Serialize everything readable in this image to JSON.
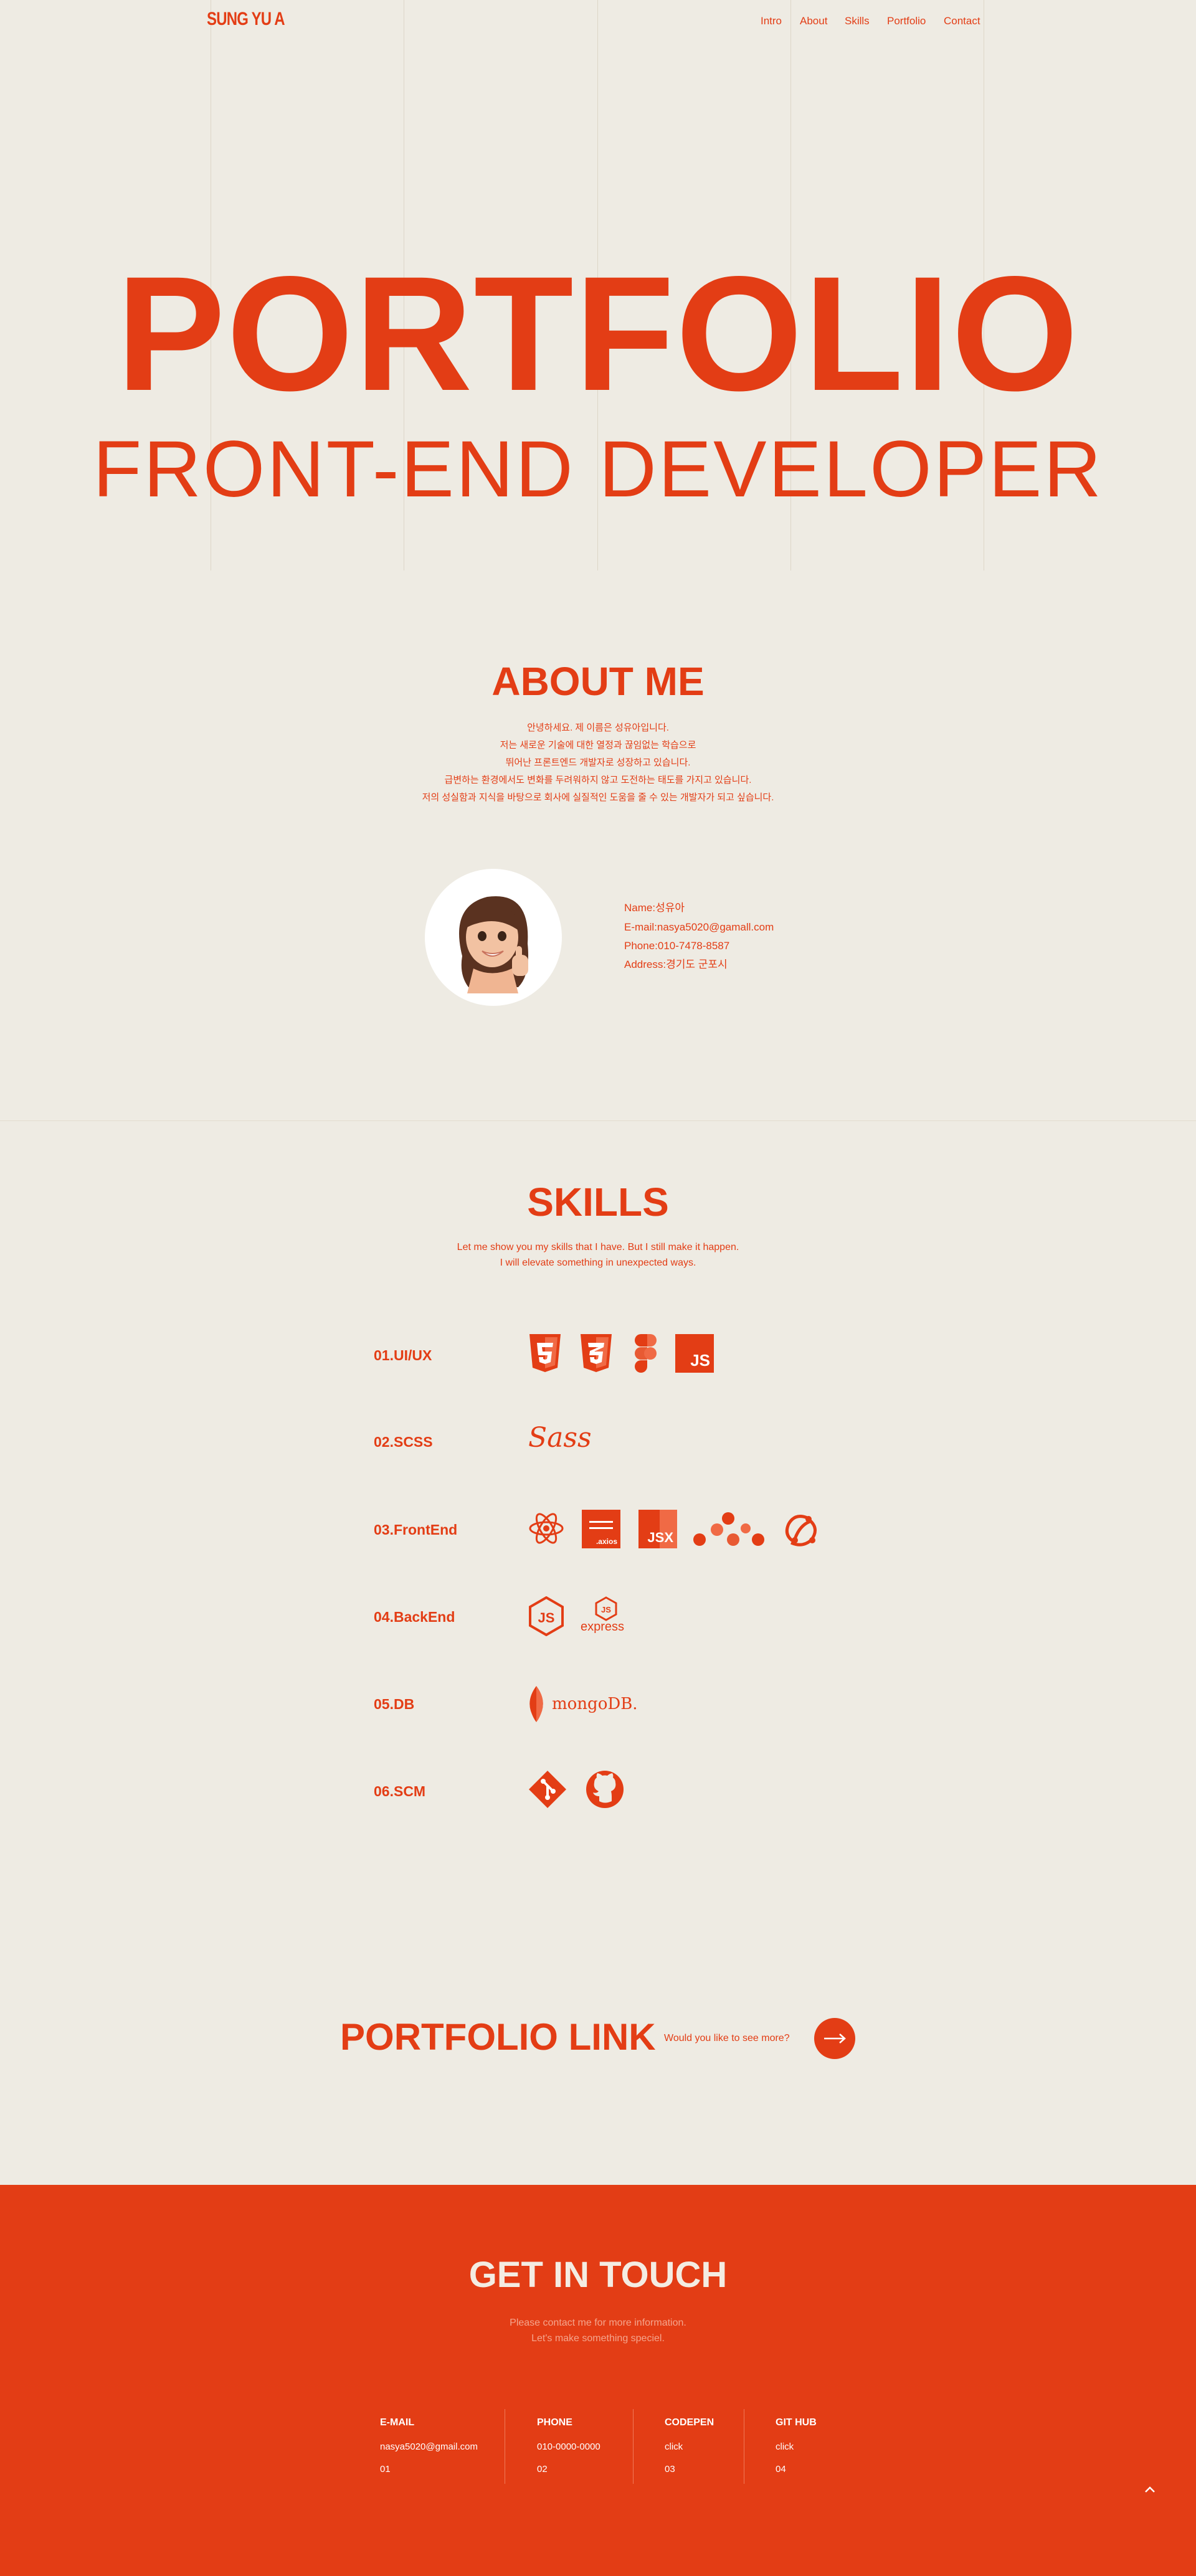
{
  "header": {
    "logo": "SUNG YU A",
    "nav": [
      "Intro",
      "About",
      "Skills",
      "Portfolio",
      "Contact"
    ]
  },
  "hero": {
    "title": "PORTFOLIO",
    "subtitle": "FRONT-END DEVELOPER"
  },
  "about": {
    "title": "ABOUT ME",
    "lines": [
      "안녕하세요. 제 이름은 성유아입니다.",
      "저는 새로운 기술에 대한 열정과 끊임없는 학습으로",
      "뛰어난 프론트엔드 개발자로 성장하고 있습니다.",
      "급변하는 환경에서도 변화를 두려워하지 않고 도전하는 태도를 가지고 있습니다.",
      "저의 성실함과 지식을 바탕으로 회사에 실질적인 도움을 줄 수 있는 개발자가 되고 싶습니다."
    ],
    "avatar_icon": "memoji-avatar-icon",
    "info": [
      "Name:성유아",
      "E-mail:nasya5020@gamall.com",
      "Phone:010-7478-8587",
      "Address:경기도 군포시"
    ]
  },
  "skills": {
    "title": "SKILLS",
    "intro": [
      "Let me show you my skills that I have. But I still make it happen.",
      "I will elevate something in unexpected ways."
    ],
    "rows": [
      {
        "label": "01.UI/UX",
        "icons": [
          "html5-icon",
          "css3-icon",
          "figma-icon",
          "javascript-icon"
        ]
      },
      {
        "label": "02.SCSS",
        "icons": [
          "sass-icon"
        ]
      },
      {
        "label": "03.FrontEnd",
        "icons": [
          "react-icon",
          "axios-icon",
          "jsx-icon",
          "bit-icon",
          "redux-icon"
        ]
      },
      {
        "label": "04.BackEnd",
        "icons": [
          "nodejs-icon",
          "express-icon"
        ]
      },
      {
        "label": "05.DB",
        "icons": [
          "mongodb-icon"
        ]
      },
      {
        "label": "06.SCM",
        "icons": [
          "git-icon",
          "github-icon"
        ]
      }
    ],
    "axios_text": ".axios",
    "jsx_text": "JSX",
    "sass_text": "Sass",
    "express_text": "express",
    "mongo_text": "mongoDB.",
    "js_text": "JS"
  },
  "portfolio": {
    "title": "PORTFOLIO LINK",
    "prompt": "Would you like to see more?",
    "arrow_icon": "arrow-right-icon"
  },
  "contact": {
    "title": "GET IN TOUCH",
    "lines": [
      "Please contact me for more information.",
      "Let's make something speciel."
    ],
    "columns": [
      {
        "head": "E-MAIL",
        "value": "nasya5020@gmail.com",
        "num": "01"
      },
      {
        "head": "PHONE",
        "value": "010-0000-0000",
        "num": "02"
      },
      {
        "head": "CODEPEN",
        "value": "click",
        "num": "03"
      },
      {
        "head": "GIT HUB",
        "value": "click",
        "num": "04"
      }
    ],
    "top_icon": "chevron-up-icon"
  },
  "colors": {
    "accent": "#e33d15",
    "background": "#eeebe3",
    "footer_text_dim": "#f5a58d"
  }
}
